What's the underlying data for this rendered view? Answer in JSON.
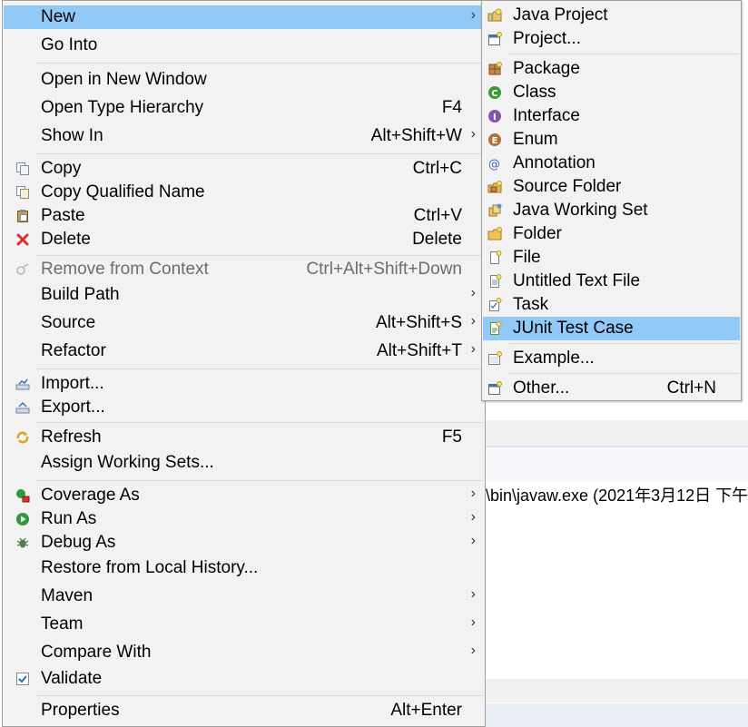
{
  "main_menu": {
    "items": [
      {
        "label": "New",
        "accel": "",
        "submenu": true,
        "icon": "none",
        "highlight": true,
        "disabled": false
      },
      {
        "label": "Go Into",
        "accel": "",
        "submenu": false,
        "icon": "none",
        "highlight": false,
        "disabled": false
      },
      {
        "label": "Open in New Window",
        "accel": "",
        "submenu": false,
        "icon": "none",
        "highlight": false,
        "disabled": false
      },
      {
        "label": "Open Type Hierarchy",
        "accel": "F4",
        "submenu": false,
        "icon": "none",
        "highlight": false,
        "disabled": false
      },
      {
        "label": "Show In",
        "accel": "Alt+Shift+W",
        "submenu": true,
        "icon": "none",
        "highlight": false,
        "disabled": false
      },
      {
        "label": "Copy",
        "accel": "Ctrl+C",
        "submenu": false,
        "icon": "copy-icon",
        "highlight": false,
        "disabled": false
      },
      {
        "label": "Copy Qualified Name",
        "accel": "",
        "submenu": false,
        "icon": "copy-qualified-icon",
        "highlight": false,
        "disabled": false
      },
      {
        "label": "Paste",
        "accel": "Ctrl+V",
        "submenu": false,
        "icon": "paste-icon",
        "highlight": false,
        "disabled": false
      },
      {
        "label": "Delete",
        "accel": "Delete",
        "submenu": false,
        "icon": "delete-icon",
        "highlight": false,
        "disabled": false
      },
      {
        "label": "Remove from Context",
        "accel": "Ctrl+Alt+Shift+Down",
        "submenu": false,
        "icon": "remove-context-icon",
        "highlight": false,
        "disabled": true
      },
      {
        "label": "Build Path",
        "accel": "",
        "submenu": true,
        "icon": "none",
        "highlight": false,
        "disabled": false
      },
      {
        "label": "Source",
        "accel": "Alt+Shift+S",
        "submenu": true,
        "icon": "none",
        "highlight": false,
        "disabled": false
      },
      {
        "label": "Refactor",
        "accel": "Alt+Shift+T",
        "submenu": true,
        "icon": "none",
        "highlight": false,
        "disabled": false
      },
      {
        "label": "Import...",
        "accel": "",
        "submenu": false,
        "icon": "import-icon",
        "highlight": false,
        "disabled": false
      },
      {
        "label": "Export...",
        "accel": "",
        "submenu": false,
        "icon": "export-icon",
        "highlight": false,
        "disabled": false
      },
      {
        "label": "Refresh",
        "accel": "F5",
        "submenu": false,
        "icon": "refresh-icon",
        "highlight": false,
        "disabled": false
      },
      {
        "label": "Assign Working Sets...",
        "accel": "",
        "submenu": false,
        "icon": "none",
        "highlight": false,
        "disabled": false
      },
      {
        "label": "Coverage As",
        "accel": "",
        "submenu": true,
        "icon": "coverage-icon",
        "highlight": false,
        "disabled": false
      },
      {
        "label": "Run As",
        "accel": "",
        "submenu": true,
        "icon": "run-icon",
        "highlight": false,
        "disabled": false
      },
      {
        "label": "Debug As",
        "accel": "",
        "submenu": true,
        "icon": "debug-icon",
        "highlight": false,
        "disabled": false
      },
      {
        "label": "Restore from Local History...",
        "accel": "",
        "submenu": false,
        "icon": "none",
        "highlight": false,
        "disabled": false
      },
      {
        "label": "Maven",
        "accel": "",
        "submenu": true,
        "icon": "none",
        "highlight": false,
        "disabled": false
      },
      {
        "label": "Team",
        "accel": "",
        "submenu": true,
        "icon": "none",
        "highlight": false,
        "disabled": false
      },
      {
        "label": "Compare With",
        "accel": "",
        "submenu": true,
        "icon": "none",
        "highlight": false,
        "disabled": false
      },
      {
        "label": "Validate",
        "accel": "",
        "submenu": false,
        "icon": "validate-check-icon",
        "highlight": false,
        "disabled": false
      },
      {
        "label": "Properties",
        "accel": "Alt+Enter",
        "submenu": false,
        "icon": "none",
        "highlight": false,
        "disabled": false
      }
    ]
  },
  "sub_menu": {
    "items": [
      {
        "label": "Java Project",
        "accel": "",
        "icon": "java-project-icon",
        "highlight": false
      },
      {
        "label": "Project...",
        "accel": "",
        "icon": "project-icon",
        "highlight": false
      },
      {
        "label": "Package",
        "accel": "",
        "icon": "package-icon",
        "highlight": false
      },
      {
        "label": "Class",
        "accel": "",
        "icon": "class-icon",
        "highlight": false
      },
      {
        "label": "Interface",
        "accel": "",
        "icon": "interface-icon",
        "highlight": false
      },
      {
        "label": "Enum",
        "accel": "",
        "icon": "enum-icon",
        "highlight": false
      },
      {
        "label": "Annotation",
        "accel": "",
        "icon": "annotation-icon",
        "highlight": false
      },
      {
        "label": "Source Folder",
        "accel": "",
        "icon": "source-folder-icon",
        "highlight": false
      },
      {
        "label": "Java Working Set",
        "accel": "",
        "icon": "working-set-icon",
        "highlight": false
      },
      {
        "label": "Folder",
        "accel": "",
        "icon": "folder-icon",
        "highlight": false
      },
      {
        "label": "File",
        "accel": "",
        "icon": "file-icon",
        "highlight": false
      },
      {
        "label": "Untitled Text File",
        "accel": "",
        "icon": "text-file-icon",
        "highlight": false
      },
      {
        "label": "Task",
        "accel": "",
        "icon": "task-icon",
        "highlight": false
      },
      {
        "label": "JUnit Test Case",
        "accel": "",
        "icon": "junit-test-case-icon",
        "highlight": true
      },
      {
        "label": "Example...",
        "accel": "",
        "icon": "example-icon",
        "highlight": false
      },
      {
        "label": "Other...",
        "accel": "Ctrl+N",
        "icon": "other-icon",
        "highlight": false
      }
    ]
  },
  "background": {
    "console_line": "\\bin\\javaw.exe (2021年3月12日 下午"
  },
  "colors": {
    "highlight": "#91c9f7",
    "menu_bg": "#f2f2f2",
    "disabled_text": "#6d6d6d"
  }
}
